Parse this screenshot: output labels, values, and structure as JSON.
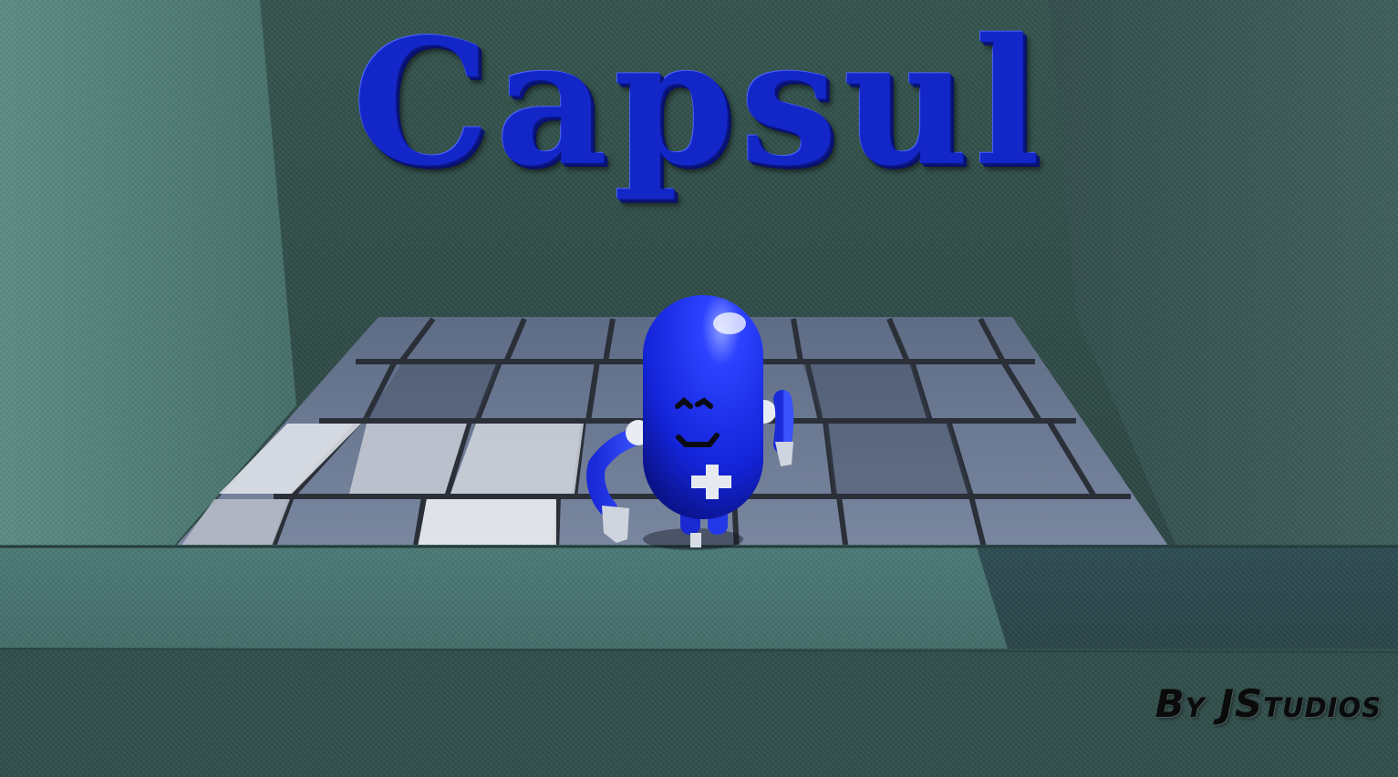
{
  "screen": {
    "title": "Capsul",
    "credit": "By JStudios"
  },
  "colors": {
    "title_blue": "#1326c8",
    "wall_teal": "#4a7070",
    "floor_tile": "#6a7590",
    "character_blue": "#1a2ee0"
  },
  "icons": {
    "character": "capsule-character-icon",
    "cross": "cross-icon"
  }
}
